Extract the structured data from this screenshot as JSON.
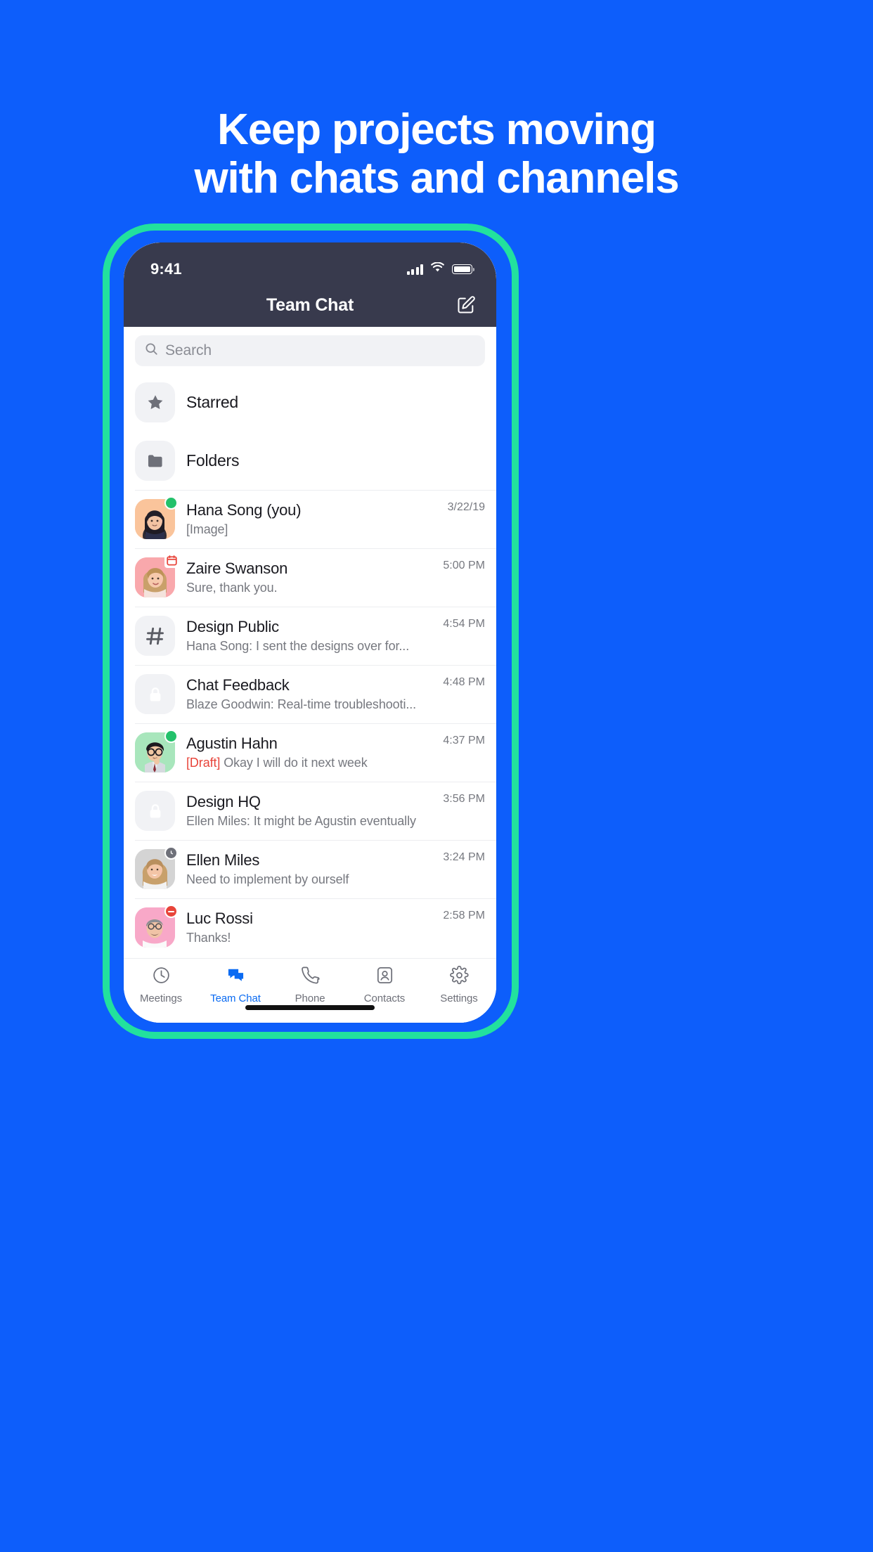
{
  "headline": {
    "line1": "Keep projects moving",
    "line2": "with chats and channels"
  },
  "colors": {
    "background": "#0D5EFB",
    "frame_accent": "#22E19E",
    "navbar": "#383A4D",
    "tab_active": "#0B6BF2",
    "draft": "#E8443A",
    "status_available": "#23C16B",
    "status_dnd": "#E8443A",
    "status_away": "#6E7079"
  },
  "statusbar": {
    "time": "9:41",
    "icons": [
      "signal-icon",
      "wifi-icon",
      "battery-icon"
    ]
  },
  "navbar": {
    "title": "Team Chat",
    "compose_icon": "compose-icon"
  },
  "search": {
    "placeholder": "Search",
    "value": "",
    "icon": "search-icon"
  },
  "shortcuts": [
    {
      "label": "Starred",
      "icon": "star-icon"
    },
    {
      "label": "Folders",
      "icon": "folder-icon"
    }
  ],
  "chats": [
    {
      "name": "Hana Song (you)",
      "preview": "[Image]",
      "time": "3/22/19",
      "avatar": "photo-hana",
      "avatar_bg": "#FAC49B",
      "badge": "available",
      "draft": false
    },
    {
      "name": "Zaire Swanson",
      "preview": "Sure, thank you.",
      "time": "5:00 PM",
      "avatar": "photo-zaire",
      "avatar_bg": "#F9A8AC",
      "badge": "meeting",
      "draft": false
    },
    {
      "name": "Design Public",
      "preview": "Hana Song: I sent the designs over for...",
      "time": "4:54 PM",
      "avatar": "hash-icon",
      "avatar_bg": "#F1F2F5",
      "badge": "none",
      "draft": false
    },
    {
      "name": "Chat Feedback",
      "preview": "Blaze Goodwin: Real-time troubleshooti...",
      "time": "4:48 PM",
      "avatar": "lock-icon",
      "avatar_bg": "#F1F2F5",
      "badge": "none",
      "draft": false
    },
    {
      "name": "Agustin Hahn",
      "preview_draft": "[Draft]",
      "preview": " Okay I will do it next week",
      "time": "4:37 PM",
      "avatar": "photo-agustin",
      "avatar_bg": "#A8E6BC",
      "badge": "available",
      "draft": true
    },
    {
      "name": "Design HQ",
      "preview": "Ellen Miles: It might be Agustin eventually",
      "time": "3:56 PM",
      "avatar": "lock-icon",
      "avatar_bg": "#F1F2F5",
      "badge": "none",
      "draft": false
    },
    {
      "name": "Ellen Miles",
      "preview": "Need to implement by ourself",
      "time": "3:24 PM",
      "avatar": "photo-ellen",
      "avatar_bg": "#D8D8D8",
      "badge": "away",
      "draft": false
    },
    {
      "name": "Luc Rossi",
      "preview": "Thanks!",
      "time": "2:58 PM",
      "avatar": "photo-luc",
      "avatar_bg": "#F8A8C8",
      "badge": "dnd",
      "draft": false
    }
  ],
  "tabbar": {
    "items": [
      {
        "label": "Meetings",
        "icon": "clock-icon",
        "active": false
      },
      {
        "label": "Team Chat",
        "icon": "chat-bubbles-icon",
        "active": true
      },
      {
        "label": "Phone",
        "icon": "phone-icon",
        "active": false
      },
      {
        "label": "Contacts",
        "icon": "contacts-icon",
        "active": false
      },
      {
        "label": "Settings",
        "icon": "gear-icon",
        "active": false
      }
    ]
  }
}
